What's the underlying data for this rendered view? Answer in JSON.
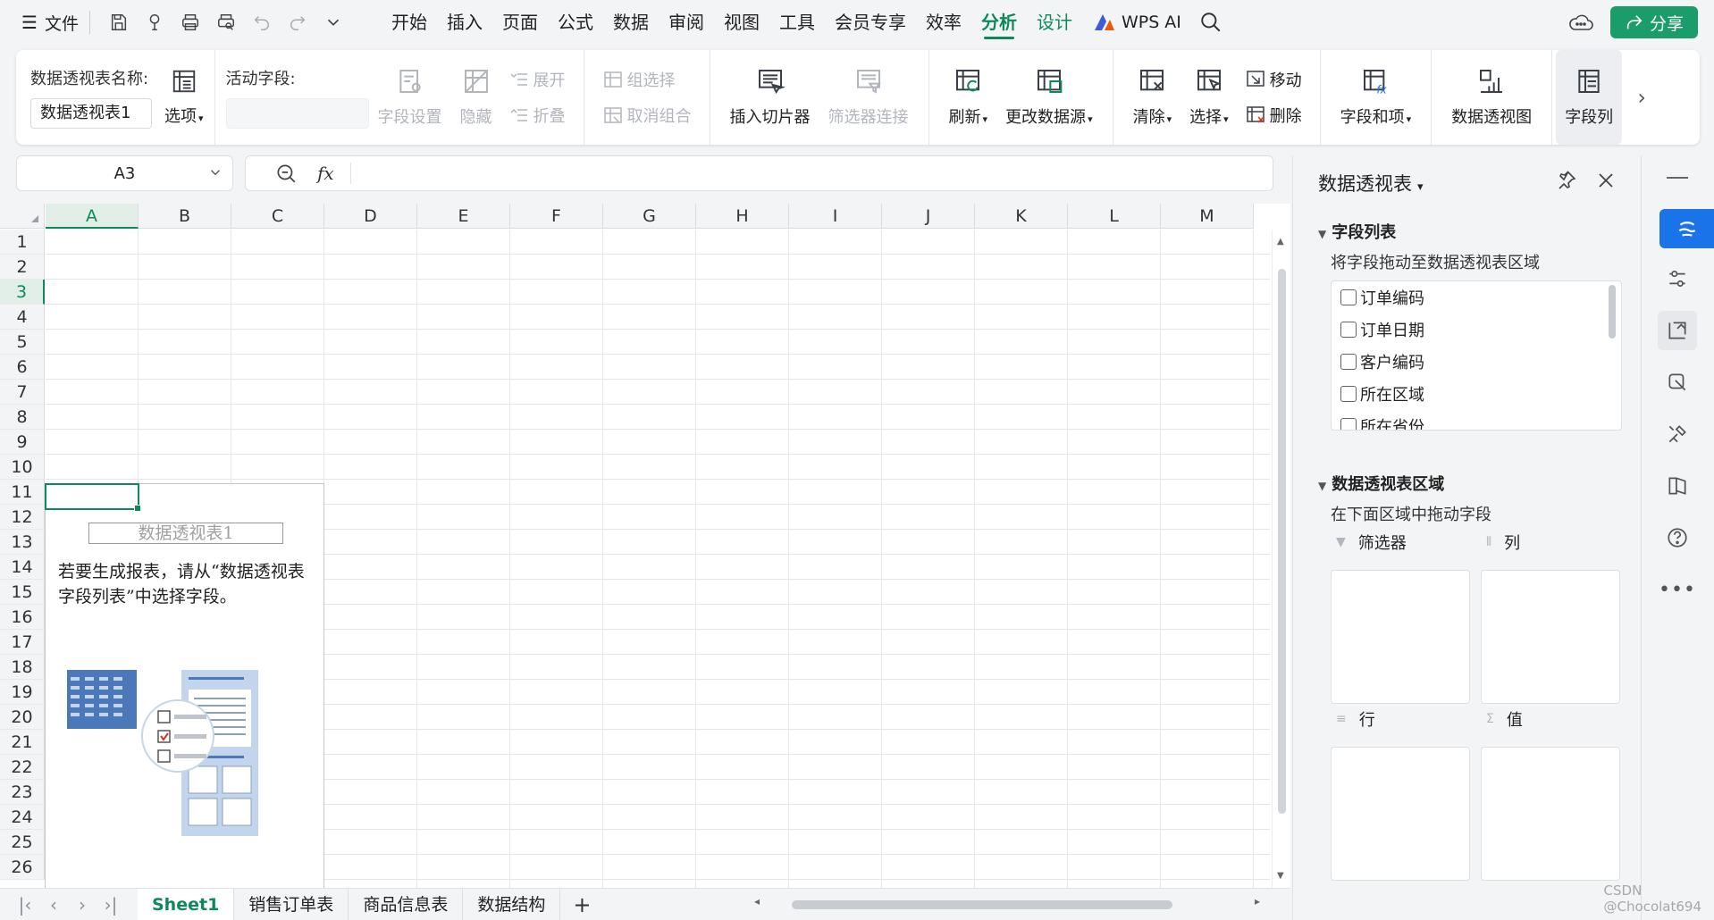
{
  "menubar": {
    "file_label": "文件",
    "tabs": [
      "开始",
      "插入",
      "页面",
      "公式",
      "数据",
      "审阅",
      "视图",
      "工具",
      "会员专享",
      "效率",
      "分析",
      "设计"
    ],
    "active_tab": "分析",
    "wps_ai_label": "WPS AI",
    "share_label": "分享"
  },
  "ribbon": {
    "pivot_name_label": "数据透视表名称:",
    "pivot_name_value": "数据透视表1",
    "options_label": "选项",
    "active_field_label": "活动字段:",
    "active_field_value": "",
    "field_settings": "字段设置",
    "hide": "隐藏",
    "expand": "展开",
    "collapse": "折叠",
    "group_select": "组选择",
    "ungroup": "取消组合",
    "insert_slicer": "插入切片器",
    "filter_connection": "筛选器连接",
    "refresh": "刷新",
    "change_source": "更改数据源",
    "clear": "清除",
    "select": "选择",
    "move": "移动",
    "delete": "删除",
    "fields_items": "字段和项",
    "pivot_chart": "数据透视图",
    "field_list_btn": "字段列"
  },
  "formula_bar": {
    "cell_ref": "A3",
    "fx_symbol": "fx",
    "formula": ""
  },
  "grid": {
    "columns": [
      "A",
      "B",
      "C",
      "D",
      "E",
      "F",
      "G",
      "H",
      "I",
      "J",
      "K",
      "L",
      "M"
    ],
    "rows": [
      "1",
      "2",
      "3",
      "4",
      "5",
      "6",
      "7",
      "8",
      "9",
      "10",
      "11",
      "12",
      "13",
      "14",
      "15",
      "16",
      "17",
      "18",
      "19",
      "20",
      "21",
      "22",
      "23",
      "24",
      "25",
      "26"
    ],
    "selected_column": "A",
    "selected_row": "3"
  },
  "pivot_placeholder": {
    "title": "数据透视表1",
    "description": "若要生成报表，请从“数据透视表字段列表”中选择字段。"
  },
  "sheets": {
    "tabs": [
      "Sheet1",
      "销售订单表",
      "商品信息表",
      "数据结构"
    ],
    "active": "Sheet1",
    "add_label": "+"
  },
  "panel": {
    "title": "数据透视表",
    "field_list_title": "字段列表",
    "field_list_hint": "将字段拖动至数据透视表区域",
    "fields": [
      "订单编码",
      "订单日期",
      "客户编码",
      "所在区域",
      "所在省份"
    ],
    "areas_title": "数据透视表区域",
    "areas_hint": "在下面区域中拖动字段",
    "area_filter": "筛选器",
    "area_columns": "列",
    "area_rows": "行",
    "area_values": "值"
  },
  "watermark": "CSDN @Chocolat694",
  "colors": {
    "accent_green": "#0c8a5a",
    "share_green": "#1b9d6b",
    "side_blue": "#1a73e8"
  }
}
